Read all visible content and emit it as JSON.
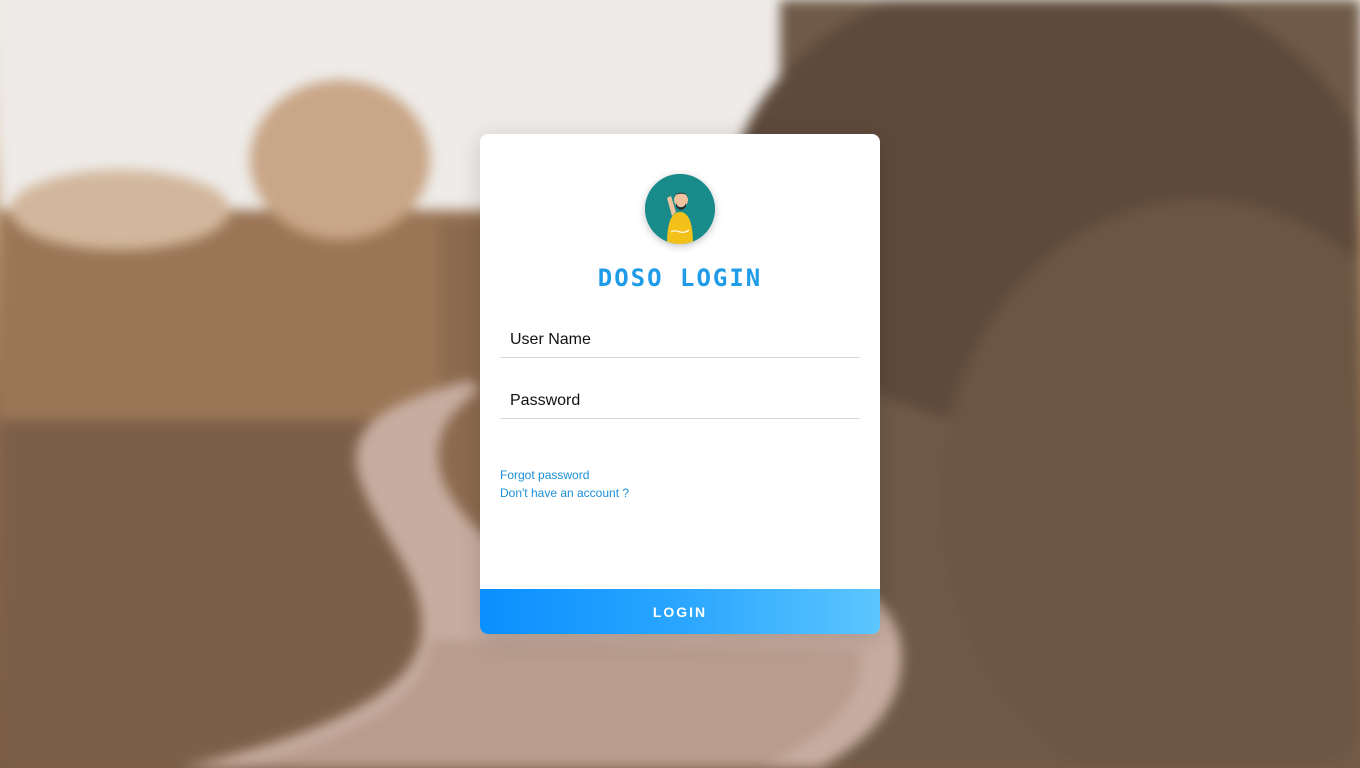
{
  "login": {
    "title": "DOSO LOGIN",
    "username_placeholder": "User Name",
    "password_placeholder": "Password",
    "forgot_link": "Forgot password",
    "signup_link": "Don't have an account ?",
    "login_button": "LOGIN"
  },
  "colors": {
    "title": "#1e9be9",
    "link": "#1a8fd6",
    "button_start": "#0a8fff",
    "button_end": "#5cc6ff",
    "avatar_bg": "#1a8b8b"
  },
  "icons": {
    "avatar": "user-avatar-icon"
  }
}
